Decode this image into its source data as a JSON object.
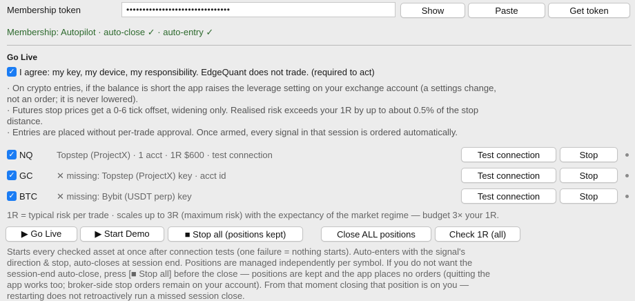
{
  "token": {
    "label": "Membership token",
    "value": "••••••••••••••••••••••••••••••••",
    "show_label": "Show",
    "paste_label": "Paste",
    "get_label": "Get token"
  },
  "membership_status": "Membership: Autopilot · auto-close ✓ · auto-entry ✓",
  "golive": {
    "heading": "Go Live",
    "agree_text": "I agree: my key, my device, my responsibility. EdgeQuant does not trade. (required to act)",
    "notes": [
      "· On crypto entries, if the balance is short the app raises the leverage setting on your exchange account (a settings change,",
      "not an order; it is never lowered).",
      "· Futures stop prices get a 0-6 tick offset, widening only. Realised risk exceeds your 1R by up to about 0.5% of the stop",
      "distance.",
      "· Entries are placed without per-trade approval. Once armed, every signal in that session is ordered automatically."
    ]
  },
  "assets": [
    {
      "symbol": "NQ",
      "detail": "Topstep (ProjectX) · 1 acct · 1R $600 · test connection",
      "test_label": "Test connection",
      "stop_label": "Stop"
    },
    {
      "symbol": "GC",
      "detail": "✕ missing: Topstep (ProjectX) key · acct id",
      "test_label": "Test connection",
      "stop_label": "Stop"
    },
    {
      "symbol": "BTC",
      "detail": "✕ missing: Bybit (USDT perp) key",
      "test_label": "Test connection",
      "stop_label": "Stop"
    }
  ],
  "risk_note": "1R = typical risk per trade · scales up to 3R (maximum risk) with the expectancy of the market regime — budget 3× your 1R.",
  "actions": {
    "golive_label": "▶ Go Live",
    "demo_label": "▶ Start Demo",
    "stopall_label": "■ Stop all (positions kept)",
    "closeall_label": "Close ALL positions",
    "check_label": "Check 1R (all)"
  },
  "description": [
    "Starts every checked asset at once after connection tests (one failure = nothing starts). Auto-enters with the signal's",
    "direction & stop, auto-closes at session end. Positions are managed independently per symbol. If you do not want the",
    "session-end auto-close, press [■ Stop all] before the close — positions are kept and the app places no orders (quitting the",
    "app works too; broker-side stop orders remain on your account). From that moment closing that position is on you —",
    "restarting does not retroactively run a missed session close."
  ],
  "colors": {
    "accent": "#1a7cf4",
    "status_green": "#2e6a2e",
    "background": "#ececec"
  }
}
